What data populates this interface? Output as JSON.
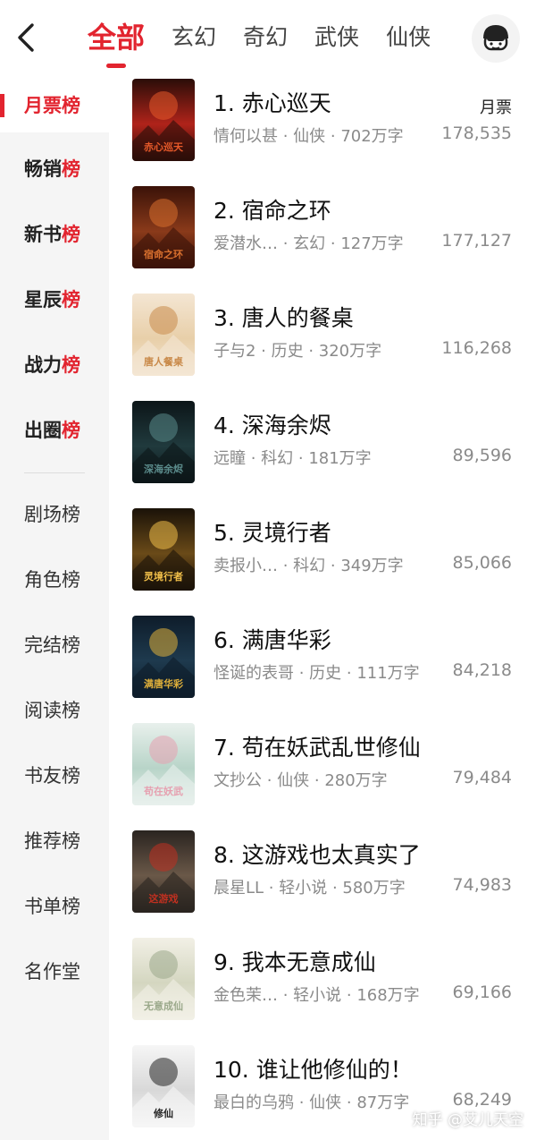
{
  "header": {
    "tabs": [
      "全部",
      "玄幻",
      "奇幻",
      "武侠",
      "仙侠"
    ],
    "back_icon": "chevron-left-icon",
    "avatar_icon": "mascot-avatar-icon"
  },
  "sidebar": {
    "items": [
      {
        "prefix": "月票",
        "suffix": "榜"
      },
      {
        "prefix": "畅销",
        "suffix": "榜"
      },
      {
        "prefix": "新书",
        "suffix": "榜"
      },
      {
        "prefix": "星辰",
        "suffix": "榜"
      },
      {
        "prefix": "战力",
        "suffix": "榜"
      },
      {
        "prefix": "出圈",
        "suffix": "榜"
      }
    ],
    "plain_items": [
      "剧场榜",
      "角色榜",
      "完结榜",
      "阅读榜",
      "书友榜",
      "推荐榜",
      "书单榜",
      "名作堂"
    ]
  },
  "list": {
    "column_label": "月票",
    "rows": [
      {
        "title": "1. 赤心巡天",
        "meta": "情何以甚 · 仙侠 · 702万字",
        "count": "178,535",
        "cover_text": "赤心巡天",
        "colors": [
          "#2a0d08",
          "#b0231a",
          "#e85a2a"
        ]
      },
      {
        "title": "2. 宿命之环",
        "meta": "爱潜水…   · 玄幻 · 127万字",
        "count": "177,127",
        "cover_text": "宿命之环",
        "colors": [
          "#3a1208",
          "#8a3a1a",
          "#d9702e"
        ]
      },
      {
        "title": "3. 唐人的餐桌",
        "meta": "子与2 · 历史 · 320万字",
        "count": "116,268",
        "cover_text": "唐人餐桌",
        "colors": [
          "#f4e6d3",
          "#e8cfa9",
          "#c98a4a"
        ]
      },
      {
        "title": "4. 深海余烬",
        "meta": "远瞳 · 科幻 · 181万字",
        "count": "89,596",
        "cover_text": "深海余烬",
        "colors": [
          "#0c1518",
          "#203a3d",
          "#5a8a8a"
        ]
      },
      {
        "title": "5. 灵境行者",
        "meta": "卖报小…   · 科幻 · 349万字",
        "count": "85,066",
        "cover_text": "灵境行者",
        "colors": [
          "#1a1208",
          "#6a4a18",
          "#f2c04a"
        ]
      },
      {
        "title": "6. 满唐华彩",
        "meta": "怪诞的表哥 · 历史 · 111万字",
        "count": "84,218",
        "cover_text": "满唐华彩",
        "colors": [
          "#0e1c2a",
          "#1e3a4e",
          "#e0b03a"
        ]
      },
      {
        "title": "7. 苟在妖武乱世修仙",
        "meta": "文抄公 · 仙侠 · 280万字",
        "count": "79,484",
        "cover_text": "苟在妖武",
        "colors": [
          "#e8f0ec",
          "#b8d4c8",
          "#e6a0b0"
        ]
      },
      {
        "title": "8. 这游戏也太真实了",
        "meta": "晨星LL · 轻小说 · 580万字",
        "count": "74,983",
        "cover_text": "这游戏",
        "colors": [
          "#2a2420",
          "#6a5848",
          "#c03020"
        ]
      },
      {
        "title": "9. 我本无意成仙",
        "meta": "金色茉…   · 轻小说 · 168万字",
        "count": "69,166",
        "cover_text": "无意成仙",
        "colors": [
          "#f2f0e6",
          "#d4d6c0",
          "#9aa88a"
        ]
      },
      {
        "title": "10. 谁让他修仙的！",
        "meta": "最白的乌鸦 · 仙侠 · 87万字",
        "count": "68,249",
        "cover_text": "修仙",
        "colors": [
          "#f6f6f6",
          "#d8d8d8",
          "#222222"
        ]
      }
    ]
  },
  "watermark": "知乎 @艾儿天空"
}
